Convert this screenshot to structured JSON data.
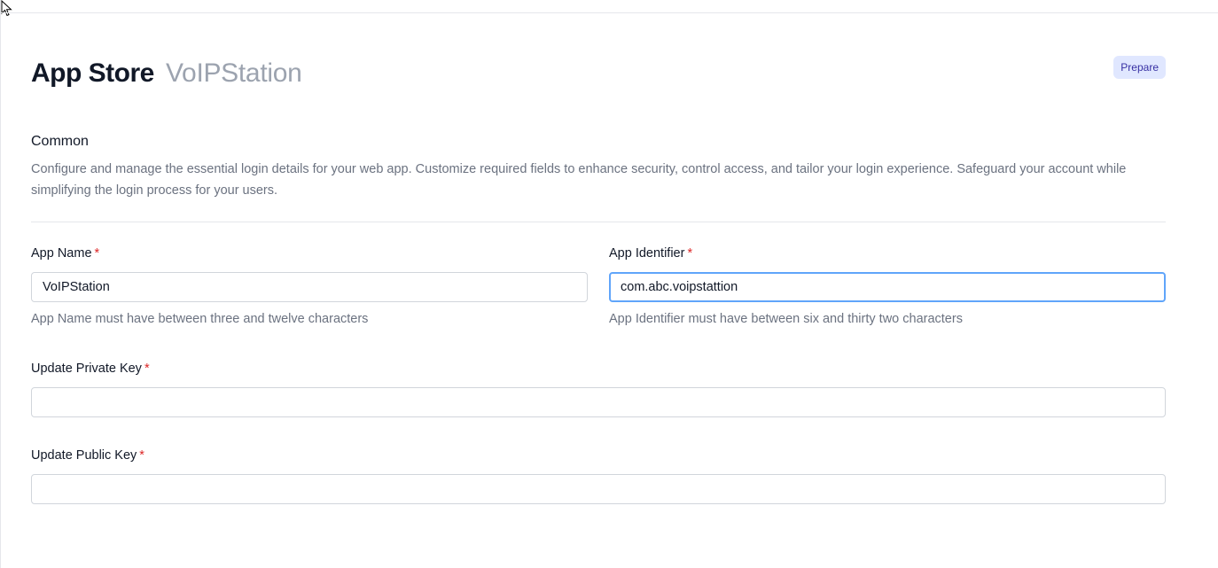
{
  "header": {
    "title": "App Store",
    "subtitle": "VoIPStation",
    "status_badge": "Prepare"
  },
  "section": {
    "title": "Common",
    "description": "Configure and manage the essential login details for your web app. Customize required fields to enhance security, control access, and tailor your login experience. Safeguard your account while simplifying the login process for your users."
  },
  "fields": {
    "app_name": {
      "label": "App Name",
      "required_mark": "*",
      "value": "VoIPStation",
      "help": "App Name must have between three and twelve characters"
    },
    "app_identifier": {
      "label": "App Identifier",
      "required_mark": "*",
      "value": "com.abc.voipstattion",
      "help": "App Identifier must have between six and thirty two characters",
      "focused": true
    },
    "private_key": {
      "label": "Update Private Key",
      "required_mark": "*",
      "value": ""
    },
    "public_key": {
      "label": "Update Public Key",
      "required_mark": "*",
      "value": ""
    }
  },
  "colors": {
    "badge_bg": "#e0e7ff",
    "badge_text": "#3730a3",
    "required": "#dc2626",
    "focus_ring": "#60a5fa",
    "muted_text": "#6b7280"
  }
}
